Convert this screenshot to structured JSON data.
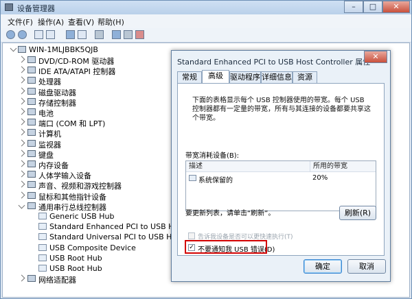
{
  "window": {
    "title": "设备管理器",
    "minimize": "–",
    "maximize": "□",
    "close": "✕"
  },
  "menu": [
    "文件(F)",
    "操作(A)",
    "查看(V)",
    "帮助(H)"
  ],
  "toolbar": [
    "back-icon",
    "forward-icon",
    "show-hide-icon",
    "tree-view-icon",
    "help-icon",
    "properties-icon",
    "device-icon",
    "update-driver-icon",
    "disable-icon",
    "uninstall-icon"
  ],
  "tree": {
    "root": "WIN-1MLJBBK5QJB",
    "items": [
      {
        "label": "DVD/CD-ROM 驱动器",
        "icon": "dvd-icon"
      },
      {
        "label": "IDE ATA/ATAPI 控制器",
        "icon": "ide-icon"
      },
      {
        "label": "处理器",
        "icon": "cpu-icon"
      },
      {
        "label": "磁盘驱动器",
        "icon": "disk-icon"
      },
      {
        "label": "存储控制器",
        "icon": "storage-icon"
      },
      {
        "label": "电池",
        "icon": "battery-icon"
      },
      {
        "label": "端口 (COM 和 LPT)",
        "icon": "port-icon"
      },
      {
        "label": "计算机",
        "icon": "computer-icon"
      },
      {
        "label": "监视器",
        "icon": "monitor-icon"
      },
      {
        "label": "键盘",
        "icon": "keyboard-icon"
      },
      {
        "label": "内存设备",
        "icon": "memory-icon"
      },
      {
        "label": "人体学输入设备",
        "icon": "hid-icon"
      },
      {
        "label": "声音、视频和游戏控制器",
        "icon": "sound-icon"
      },
      {
        "label": "鼠标和其他指针设备",
        "icon": "mouse-icon"
      },
      {
        "label": "通用串行总线控制器",
        "icon": "usb-icon",
        "expanded": true
      }
    ],
    "usb_children": [
      "Generic USB Hub",
      "Standard Enhanced PCI to USB Host Contr",
      "Standard Universal PCI to USB Host Cont",
      "USB Composite Device",
      "USB Root Hub",
      "USB Root Hub"
    ],
    "last": {
      "label": "网络适配器",
      "icon": "network-icon"
    }
  },
  "dialog": {
    "title": "Standard Enhanced PCI to USB Host Controller 属性",
    "close": "✕",
    "tabs": [
      "常规",
      "高级",
      "驱动程序",
      "详细信息",
      "资源"
    ],
    "active_tab": 1,
    "description": "下面的表格显示每个 USB 控制器使用的带宽。每个 USB 控制器都有一定量的带宽，所有与其连接的设备都要共享这个带宽。",
    "bandwidth_label": "带宽消耗设备(B):",
    "table": {
      "col_desc": "描述",
      "col_bw": "所用的带宽",
      "rows": [
        {
          "desc": "系统保留的",
          "bw": "20%"
        }
      ]
    },
    "refresh_hint": "要更新列表，请单击“刷新”。",
    "refresh_button": "刷新(R)",
    "checkbox1": {
      "label": "告诉我设备是否可以更快速执行(T)",
      "checked": false
    },
    "checkbox2": {
      "label": "不要通知我 USB 错误(D)",
      "checked": true,
      "check_mark": "✓"
    },
    "ok_button": "确定",
    "cancel_button": "取消"
  }
}
